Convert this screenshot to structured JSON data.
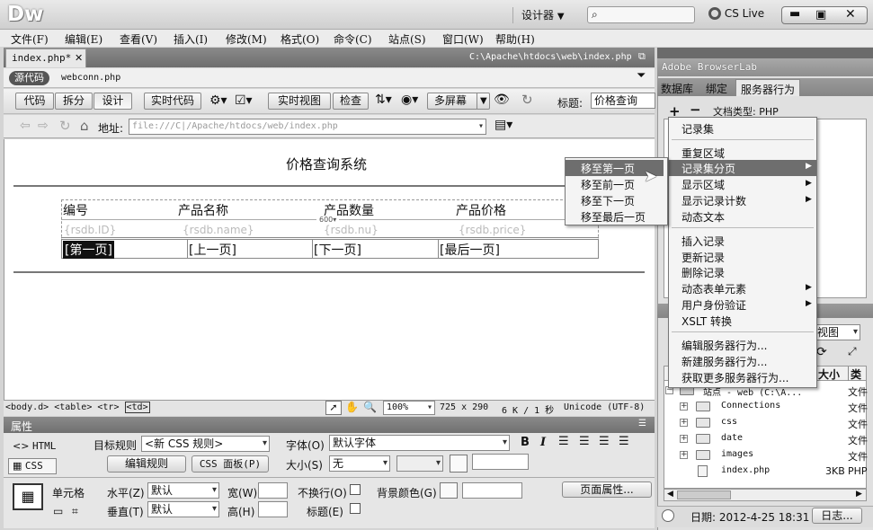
{
  "app": {
    "logo": "Dw",
    "designer": "设计器",
    "cs_live": "CS Live"
  },
  "menubar": [
    "文件(F)",
    "编辑(E)",
    "查看(V)",
    "插入(I)",
    "修改(M)",
    "格式(O)",
    "命令(C)",
    "站点(S)",
    "窗口(W)",
    "帮助(H)"
  ],
  "doc_tab": {
    "name": "index.php*",
    "path": "C:\\Apache\\htdocs\\web\\index.php"
  },
  "related": {
    "source": "源代码",
    "file": "webconn.php"
  },
  "toolbar": {
    "code": "代码",
    "split": "拆分",
    "design": "设计",
    "live_code": "实时代码",
    "live_view": "实时视图",
    "inspect": "检查",
    "multiscreen": "多屏幕",
    "title_label": "标题:",
    "title_value": "价格查询"
  },
  "address": {
    "label": "地址:",
    "value": "file:///C|/Apache/htdocs/web/index.php"
  },
  "page": {
    "heading": "价格查询系统",
    "headers": [
      "编号",
      "产品名称",
      "产品数量",
      "产品价格"
    ],
    "fields": [
      "{rsdb.ID}",
      "{rsdb.name}",
      "{rsdb.nu}",
      "{rsdb.price}"
    ],
    "table_width": "600",
    "nav": [
      "[第一页]",
      "[上一页]",
      "[下一页]",
      "[最后一页]"
    ]
  },
  "status": {
    "tags": [
      "<body.d>",
      "<table>",
      "<tr>",
      "<td>"
    ],
    "zoom": "100%",
    "size": "725 x 290",
    "weight": "6 K / 1 秒",
    "encoding": "Unicode (UTF-8)"
  },
  "props": {
    "title": "属性",
    "html": "HTML",
    "css": "CSS",
    "target_rule_label": "目标规则",
    "target_rule_value": "<新 CSS 规则>",
    "edit_rule": "编辑规则",
    "css_panel": "CSS 面板(P)",
    "font_label": "字体(O)",
    "font_value": "默认字体",
    "size_label": "大小(S)",
    "size_value": "无",
    "cell_label": "单元格",
    "h_label": "水平(Z)",
    "h_value": "默认",
    "v_label": "垂直(T)",
    "v_value": "默认",
    "w_label": "宽(W)",
    "h2_label": "高(H)",
    "nowrap": "不换行(O)",
    "header": "标题(E)",
    "bg_label": "背景颜色(G)",
    "page_props": "页面属性..."
  },
  "panels": {
    "browserlab": "Adobe BrowserLab",
    "tabs": [
      "数据库",
      "绑定",
      "服务器行为"
    ],
    "doc_type": "文档类型: PHP",
    "view": "视图",
    "col_size": "大小",
    "col_type": "类",
    "site": "站点 - web (C:\\A...",
    "site_type": "文件",
    "files": [
      {
        "name": "Connections",
        "type": "文件"
      },
      {
        "name": "css",
        "type": "文件"
      },
      {
        "name": "date",
        "type": "文件"
      },
      {
        "name": "images",
        "type": "文件"
      },
      {
        "name": "index.php",
        "size": "3KB",
        "type": "PHP"
      }
    ],
    "date_label": "日期: 2012-4-25 18:31",
    "log": "日志..."
  },
  "context_menu": {
    "items": [
      "记录集",
      "重复区域",
      "记录集分页",
      "显示区域",
      "显示记录计数",
      "动态文本",
      "插入记录",
      "更新记录",
      "删除记录",
      "动态表单元素",
      "用户身份验证",
      "XSLT 转换",
      "编辑服务器行为...",
      "新建服务器行为...",
      "获取更多服务器行为..."
    ],
    "submenu": [
      "移至第一页",
      "移至前一页",
      "移至下一页",
      "移至最后一页"
    ]
  }
}
